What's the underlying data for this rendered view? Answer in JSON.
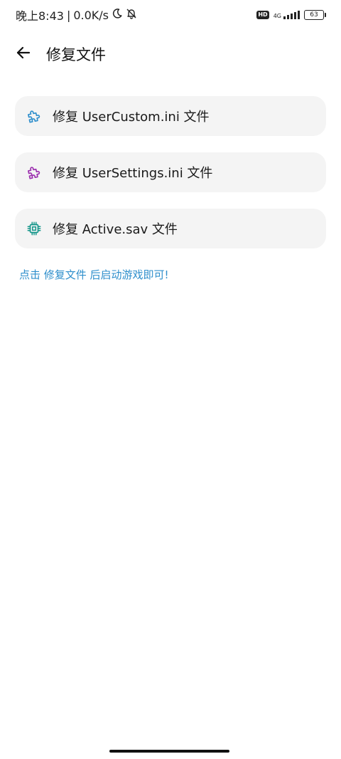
{
  "status_bar": {
    "time": "晚上8:43",
    "separator": "|",
    "speed": "0.0K/s",
    "hd_label": "HD",
    "network_label": "4G",
    "battery": "63",
    "icons": [
      "moon-icon",
      "bell-off-icon",
      "signal-icon",
      "battery-icon"
    ]
  },
  "app_bar": {
    "title": "修复文件",
    "back_icon": "arrow-left-icon"
  },
  "items": [
    {
      "label": "修复 UserCustom.ini 文件",
      "icon": "puzzle-icon",
      "color": "#2f8fcc"
    },
    {
      "label": "修复 UserSettings.ini 文件",
      "icon": "puzzle-icon",
      "color": "#9b2fae"
    },
    {
      "label": "修复 Active.sav 文件",
      "icon": "chip-icon",
      "color": "#15968a"
    }
  ],
  "hint": "点击 修复文件 后启动游戏即可!",
  "colors": {
    "accent": "#2f8fcc",
    "card_bg": "#f4f4f4"
  }
}
